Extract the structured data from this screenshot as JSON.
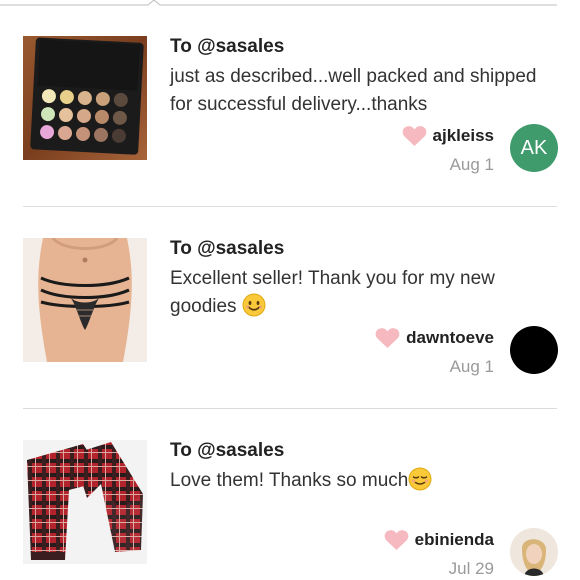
{
  "reviews": [
    {
      "to": "To @sasales",
      "text": "just as described...well packed and shipped for successful delivery...thanks",
      "username": "ajkleiss",
      "date": "Aug 1",
      "avatar_initials": "AK",
      "avatar_color": "#3f9a6c",
      "thumb_icon": "makeup-palette-image"
    },
    {
      "to": "To @sasales",
      "text": "Excellent seller! Thank you for my new goodies",
      "emoji": "smiling-face",
      "username": "dawntoeve",
      "date": "Aug 1",
      "avatar_color": "#000000",
      "thumb_icon": "lingerie-image"
    },
    {
      "to": "To @sasales",
      "text": "Love them! Thanks so much",
      "emoji": "relieved-face",
      "username": "ebinienda",
      "date": "Jul 29",
      "avatar_icon": "profile-photo",
      "thumb_icon": "plaid-pants-image"
    }
  ],
  "colors": {
    "heart": "#f7b9c0",
    "date": "#9a9a9a",
    "divider": "#dcdcdc"
  }
}
